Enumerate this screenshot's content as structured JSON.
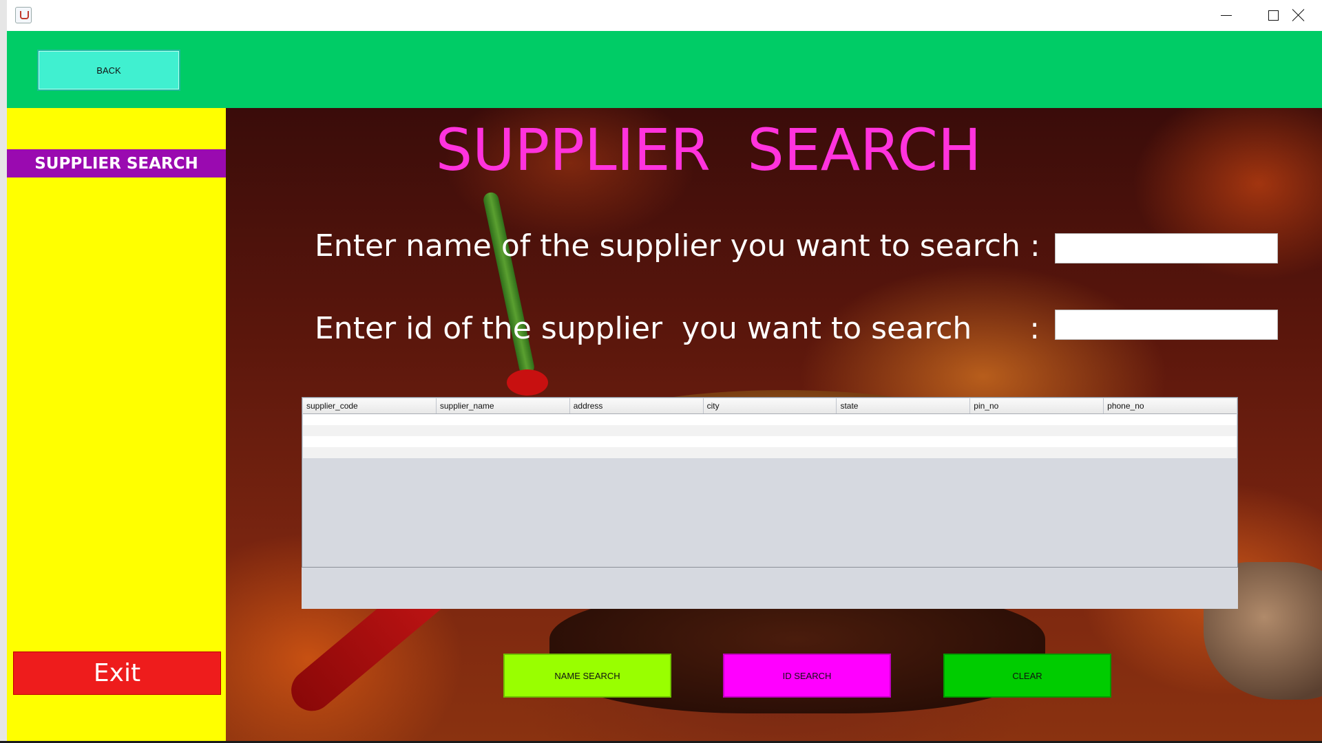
{
  "window": {
    "icon": "java-app-icon",
    "controls": [
      "minimize-icon",
      "maximize-icon",
      "close-icon"
    ]
  },
  "header": {
    "back_label": "BACK"
  },
  "sidebar": {
    "title": "SUPPLIER SEARCH",
    "exit_label": "Exit"
  },
  "main": {
    "title": "SUPPLIER  SEARCH",
    "name_prompt": "Enter name of the supplier you want to search :",
    "id_prompt": "Enter id of the supplier  you want to search      :",
    "name_input_value": "",
    "id_input_value": ""
  },
  "table": {
    "columns": [
      "supplier_code",
      "supplier_name",
      "address",
      "city",
      "state",
      "pin_no",
      "phone_no"
    ],
    "rows": []
  },
  "actions": {
    "name_search_label": "NAME SEARCH",
    "id_search_label": "ID SEARCH",
    "clear_label": "CLEAR"
  },
  "colors": {
    "header_bg": "#00cc66",
    "back_button": "#40f0d0",
    "sidebar_bg": "#ffff00",
    "sidebar_title_bg": "#9a0ab0",
    "exit_button": "#ee1c1c",
    "title_text": "#ff33dd",
    "name_search_button": "#99ff00",
    "id_search_button": "#ff00ff",
    "clear_button": "#00cc00"
  }
}
